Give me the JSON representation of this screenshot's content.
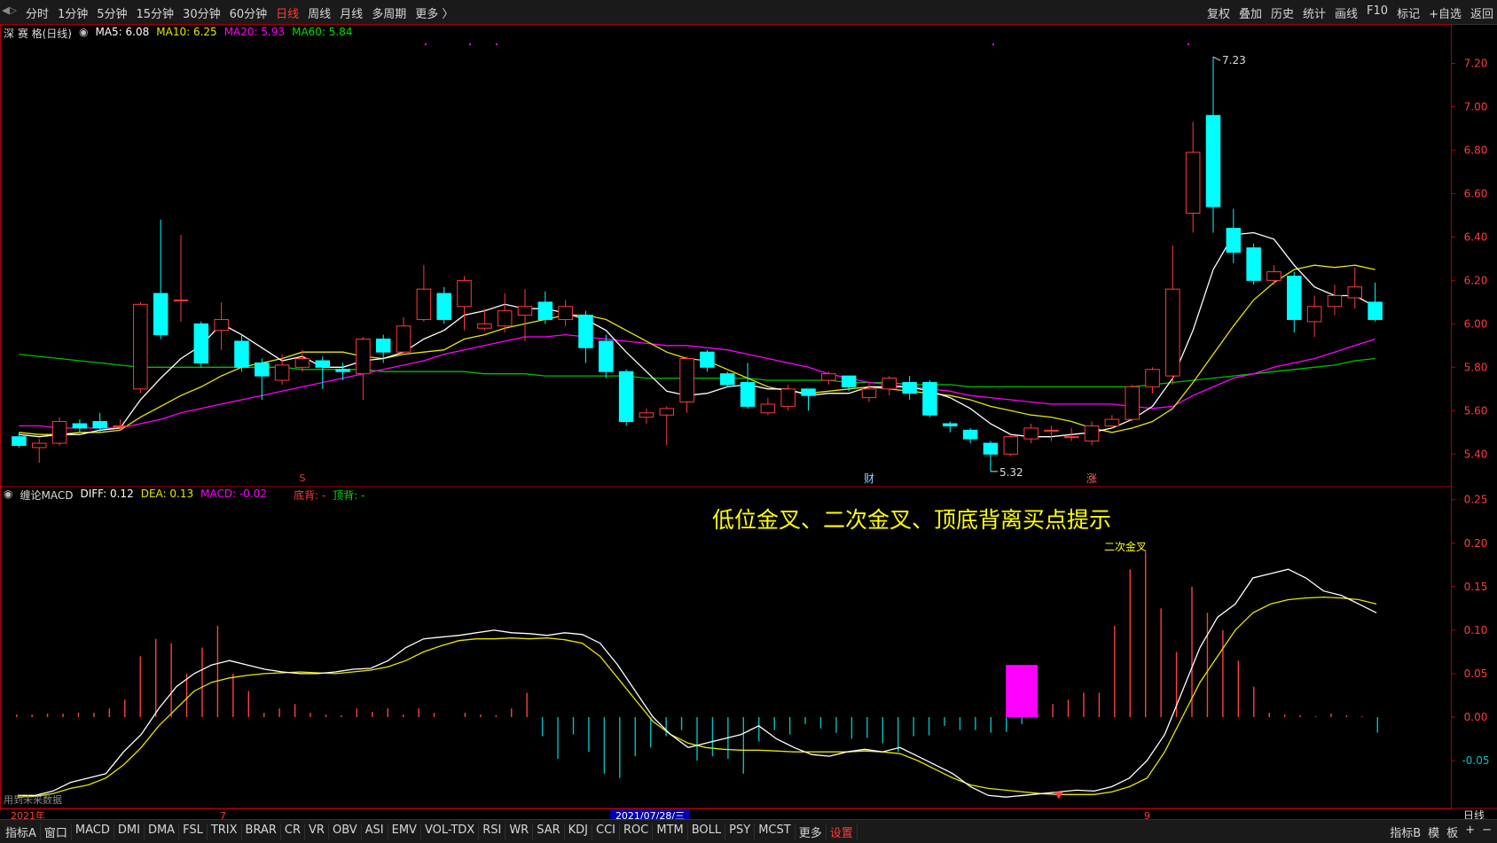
{
  "topbar": {
    "left_items": [
      "分时",
      "1分钟",
      "5分钟",
      "15分钟",
      "30分钟",
      "60分钟",
      "日线",
      "周线",
      "月线",
      "多周期",
      "更多 〉"
    ],
    "active_index": 6,
    "right_items": [
      "复权",
      "叠加",
      "历史",
      "统计",
      "画线",
      "F10",
      "标记",
      "+自选",
      "返回"
    ]
  },
  "price_header": {
    "name": "深 赛 格(日线)",
    "ma5": "MA5: 6.08",
    "ma10": "MA10: 6.25",
    "ma20": "MA20: 5.93",
    "ma60": "MA60: 5.84"
  },
  "macd_header": {
    "name": "缠论MACD",
    "diff": "DIFF: 0.12",
    "dea": "DEA: 0.13",
    "macd": "MACD: -0.02",
    "bottom_div": "底背: -",
    "top_div": "顶背: -"
  },
  "annotations": {
    "main_title": "低位金叉、二次金叉、顶底背离买点提示",
    "second_cross": "二次金叉",
    "high_label": "7.23",
    "low_label": "5.32"
  },
  "x_axis": {
    "start_label": "2021年",
    "month_labels": [
      "7",
      "9"
    ],
    "cursor_date": "2021/07/28/三",
    "period": "日线"
  },
  "markers": {
    "cai": "财",
    "zhang": "涨",
    "s": "S"
  },
  "bottom": {
    "tabs": [
      "指标A",
      "窗口",
      "MACD",
      "DMI",
      "DMA",
      "FSL",
      "TRIX",
      "BRAR",
      "CR",
      "VR",
      "OBV",
      "ASI",
      "EMV",
      "VOL-TDX",
      "RSI",
      "WR",
      "SAR",
      "KDJ",
      "CCI",
      "ROC",
      "MTM",
      "BOLL",
      "PSY",
      "MCST",
      "更多",
      "设置"
    ],
    "active_index": 25,
    "right_items": [
      "指标B",
      "模",
      "板",
      "+",
      "−"
    ],
    "future_note": "用到未来数据"
  },
  "colors": {
    "up": "#ff3b3b",
    "down": "#00ffff",
    "ma5": "#ffffff",
    "ma10": "#e6e600",
    "ma20": "#ff00ff",
    "ma60": "#00c000",
    "diff": "#ffffff",
    "dea": "#e6e600",
    "frame": "#b00000",
    "signal": "#ff00ff"
  },
  "chart_data": [
    {
      "type": "candlestick",
      "title": "深 赛 格(日线)",
      "y_ticks": [
        5.4,
        5.6,
        5.8,
        6.0,
        6.2,
        6.4,
        6.6,
        6.8,
        7.0,
        7.2
      ],
      "ylim": [
        5.25,
        7.3
      ],
      "candles": [
        [
          5.48,
          5.44,
          5.5,
          5.43
        ],
        [
          5.43,
          5.45,
          5.47,
          5.36
        ],
        [
          5.45,
          5.55,
          5.57,
          5.44
        ],
        [
          5.54,
          5.52,
          5.56,
          5.5
        ],
        [
          5.55,
          5.52,
          5.59,
          5.5
        ],
        [
          5.53,
          5.53,
          5.56,
          5.51
        ],
        [
          5.7,
          6.09,
          6.1,
          5.68
        ],
        [
          6.14,
          5.95,
          6.48,
          5.93
        ],
        [
          6.11,
          6.11,
          6.41,
          6.01
        ],
        [
          6.0,
          5.82,
          6.01,
          5.8
        ],
        [
          5.97,
          6.02,
          6.1,
          5.88
        ],
        [
          5.92,
          5.8,
          5.95,
          5.78
        ],
        [
          5.82,
          5.76,
          5.84,
          5.65
        ],
        [
          5.74,
          5.81,
          5.86,
          5.72
        ],
        [
          5.8,
          5.84,
          5.88,
          5.78
        ],
        [
          5.83,
          5.8,
          5.85,
          5.7
        ],
        [
          5.79,
          5.78,
          5.82,
          5.74
        ],
        [
          5.77,
          5.93,
          5.94,
          5.65
        ],
        [
          5.93,
          5.87,
          5.95,
          5.82
        ],
        [
          5.87,
          5.99,
          6.03,
          5.86
        ],
        [
          6.02,
          6.16,
          6.27,
          6.01
        ],
        [
          6.14,
          6.02,
          6.17,
          6.0
        ],
        [
          6.08,
          6.2,
          6.22,
          5.97
        ],
        [
          5.98,
          6.0,
          6.07,
          5.97
        ],
        [
          5.99,
          6.06,
          6.14,
          5.96
        ],
        [
          6.04,
          6.08,
          6.16,
          5.92
        ],
        [
          6.1,
          6.02,
          6.15,
          6.0
        ],
        [
          6.02,
          6.08,
          6.11,
          5.99
        ],
        [
          6.04,
          5.89,
          6.06,
          5.82
        ],
        [
          5.92,
          5.78,
          5.95,
          5.75
        ],
        [
          5.78,
          5.55,
          5.79,
          5.53
        ],
        [
          5.57,
          5.59,
          5.61,
          5.54
        ],
        [
          5.58,
          5.61,
          5.62,
          5.44
        ],
        [
          5.64,
          5.84,
          5.85,
          5.59
        ],
        [
          5.87,
          5.8,
          5.88,
          5.78
        ],
        [
          5.77,
          5.72,
          5.78,
          5.71
        ],
        [
          5.73,
          5.62,
          5.82,
          5.61
        ],
        [
          5.59,
          5.63,
          5.66,
          5.58
        ],
        [
          5.62,
          5.7,
          5.72,
          5.6
        ],
        [
          5.7,
          5.67,
          5.7,
          5.6
        ],
        [
          5.74,
          5.77,
          5.78,
          5.72
        ],
        [
          5.76,
          5.71,
          5.76,
          5.69
        ],
        [
          5.66,
          5.7,
          5.73,
          5.64
        ],
        [
          5.7,
          5.75,
          5.76,
          5.67
        ],
        [
          5.73,
          5.68,
          5.76,
          5.65
        ],
        [
          5.73,
          5.58,
          5.74,
          5.57
        ],
        [
          5.54,
          5.53,
          5.55,
          5.5
        ],
        [
          5.51,
          5.47,
          5.52,
          5.45
        ],
        [
          5.45,
          5.4,
          5.46,
          5.32
        ],
        [
          5.4,
          5.48,
          5.49,
          5.39
        ],
        [
          5.47,
          5.52,
          5.54,
          5.45
        ],
        [
          5.51,
          5.51,
          5.53,
          5.46
        ],
        [
          5.48,
          5.48,
          5.52,
          5.46
        ],
        [
          5.46,
          5.53,
          5.55,
          5.44
        ],
        [
          5.53,
          5.56,
          5.58,
          5.52
        ],
        [
          5.56,
          5.71,
          5.72,
          5.55
        ],
        [
          5.71,
          5.79,
          5.8,
          5.68
        ],
        [
          5.76,
          6.16,
          6.36,
          5.72
        ],
        [
          6.51,
          6.79,
          6.93,
          6.42
        ],
        [
          6.96,
          6.54,
          7.23,
          6.42
        ],
        [
          6.44,
          6.33,
          6.53,
          6.28
        ],
        [
          6.35,
          6.2,
          6.37,
          6.18
        ],
        [
          6.2,
          6.24,
          6.27,
          6.18
        ],
        [
          6.22,
          6.02,
          6.24,
          5.96
        ],
        [
          6.01,
          6.08,
          6.13,
          5.94
        ],
        [
          6.08,
          6.13,
          6.18,
          6.04
        ],
        [
          6.12,
          6.17,
          6.26,
          6.07
        ],
        [
          6.1,
          6.02,
          6.19,
          6.01
        ]
      ],
      "ma5": [
        5.49,
        5.48,
        5.49,
        5.49,
        5.51,
        5.52,
        5.65,
        5.75,
        5.84,
        5.9,
        6.0,
        5.95,
        5.89,
        5.83,
        5.85,
        5.8,
        5.8,
        5.83,
        5.84,
        5.87,
        5.93,
        5.97,
        6.04,
        6.06,
        6.09,
        6.07,
        6.07,
        6.05,
        6.02,
        5.97,
        5.87,
        5.78,
        5.69,
        5.67,
        5.68,
        5.71,
        5.72,
        5.7,
        5.7,
        5.67,
        5.68,
        5.68,
        5.71,
        5.71,
        5.71,
        5.69,
        5.66,
        5.61,
        5.54,
        5.49,
        5.48,
        5.48,
        5.49,
        5.5,
        5.52,
        5.56,
        5.62,
        5.75,
        5.97,
        6.25,
        6.41,
        6.42,
        6.39,
        6.27,
        6.17,
        6.13,
        6.13,
        6.08
      ],
      "ma10": [
        5.5,
        5.49,
        5.49,
        5.5,
        5.5,
        5.51,
        5.57,
        5.62,
        5.67,
        5.71,
        5.76,
        5.8,
        5.82,
        5.84,
        5.87,
        5.87,
        5.87,
        5.85,
        5.84,
        5.86,
        5.87,
        5.88,
        5.93,
        5.95,
        5.98,
        6.0,
        6.02,
        6.04,
        6.04,
        6.02,
        5.97,
        5.92,
        5.87,
        5.84,
        5.83,
        5.79,
        5.75,
        5.71,
        5.69,
        5.68,
        5.69,
        5.7,
        5.71,
        5.7,
        5.69,
        5.68,
        5.67,
        5.65,
        5.62,
        5.6,
        5.58,
        5.57,
        5.55,
        5.52,
        5.5,
        5.52,
        5.55,
        5.61,
        5.73,
        5.86,
        5.99,
        6.11,
        6.19,
        6.25,
        6.27,
        6.26,
        6.27,
        6.25
      ],
      "ma20": [
        5.53,
        5.53,
        5.52,
        5.52,
        5.52,
        5.52,
        5.54,
        5.56,
        5.59,
        5.61,
        5.63,
        5.65,
        5.67,
        5.69,
        5.71,
        5.73,
        5.75,
        5.77,
        5.79,
        5.81,
        5.83,
        5.86,
        5.88,
        5.9,
        5.92,
        5.94,
        5.94,
        5.95,
        5.94,
        5.93,
        5.92,
        5.91,
        5.9,
        5.9,
        5.89,
        5.88,
        5.86,
        5.84,
        5.82,
        5.8,
        5.77,
        5.75,
        5.73,
        5.72,
        5.71,
        5.7,
        5.69,
        5.67,
        5.66,
        5.65,
        5.64,
        5.63,
        5.63,
        5.63,
        5.63,
        5.62,
        5.61,
        5.62,
        5.67,
        5.71,
        5.75,
        5.77,
        5.8,
        5.82,
        5.84,
        5.87,
        5.9,
        5.93
      ],
      "ma60": [
        5.86,
        5.85,
        5.84,
        5.83,
        5.82,
        5.81,
        5.8,
        5.8,
        5.8,
        5.8,
        5.8,
        5.8,
        5.8,
        5.8,
        5.79,
        5.79,
        5.79,
        5.79,
        5.78,
        5.78,
        5.78,
        5.78,
        5.78,
        5.77,
        5.77,
        5.77,
        5.76,
        5.76,
        5.76,
        5.76,
        5.76,
        5.75,
        5.75,
        5.75,
        5.75,
        5.75,
        5.75,
        5.74,
        5.74,
        5.74,
        5.74,
        5.73,
        5.73,
        5.73,
        5.72,
        5.72,
        5.72,
        5.71,
        5.71,
        5.71,
        5.71,
        5.71,
        5.71,
        5.71,
        5.71,
        5.71,
        5.72,
        5.73,
        5.74,
        5.75,
        5.76,
        5.77,
        5.78,
        5.79,
        5.8,
        5.81,
        5.83,
        5.84
      ]
    },
    {
      "type": "macd",
      "title": "缠论MACD",
      "y_ticks": [
        -0.05,
        0.0,
        0.05,
        0.1,
        0.15,
        0.2,
        0.25
      ],
      "ylim": [
        -0.105,
        0.265
      ],
      "diff": [
        -0.09,
        -0.09,
        -0.085,
        -0.075,
        -0.07,
        -0.065,
        -0.04,
        -0.02,
        0.01,
        0.035,
        0.05,
        0.06,
        0.065,
        0.06,
        0.055,
        0.052,
        0.05,
        0.05,
        0.052,
        0.055,
        0.056,
        0.065,
        0.08,
        0.09,
        0.092,
        0.094,
        0.097,
        0.1,
        0.097,
        0.096,
        0.094,
        0.097,
        0.095,
        0.085,
        0.06,
        0.03,
        0.0,
        -0.02,
        -0.035,
        -0.03,
        -0.025,
        -0.02,
        -0.01,
        -0.025,
        -0.035,
        -0.043,
        -0.045,
        -0.04,
        -0.037,
        -0.04,
        -0.035,
        -0.045,
        -0.055,
        -0.065,
        -0.08,
        -0.09,
        -0.092,
        -0.09,
        -0.088,
        -0.086,
        -0.084,
        -0.085,
        -0.08,
        -0.07,
        -0.05,
        -0.02,
        0.03,
        0.08,
        0.115,
        0.13,
        0.16,
        0.165,
        0.17,
        0.16,
        0.145,
        0.14,
        0.13,
        0.12
      ],
      "dea": [
        -0.092,
        -0.091,
        -0.088,
        -0.082,
        -0.078,
        -0.07,
        -0.055,
        -0.035,
        -0.01,
        0.01,
        0.03,
        0.04,
        0.045,
        0.048,
        0.05,
        0.051,
        0.052,
        0.051,
        0.05,
        0.052,
        0.054,
        0.058,
        0.065,
        0.075,
        0.082,
        0.088,
        0.09,
        0.09,
        0.091,
        0.09,
        0.091,
        0.089,
        0.085,
        0.07,
        0.045,
        0.02,
        -0.005,
        -0.02,
        -0.03,
        -0.035,
        -0.037,
        -0.038,
        -0.038,
        -0.039,
        -0.04,
        -0.04,
        -0.04,
        -0.04,
        -0.039,
        -0.04,
        -0.042,
        -0.05,
        -0.06,
        -0.07,
        -0.078,
        -0.082,
        -0.084,
        -0.086,
        -0.088,
        -0.089,
        -0.089,
        -0.089,
        -0.086,
        -0.08,
        -0.07,
        -0.04,
        0.0,
        0.04,
        0.07,
        0.1,
        0.12,
        0.13,
        0.135,
        0.137,
        0.138,
        0.137,
        0.135,
        0.13
      ],
      "hist": [
        0.003,
        0.003,
        0.004,
        0.004,
        0.005,
        0.005,
        0.01,
        0.02,
        0.07,
        0.09,
        0.085,
        0.05,
        0.08,
        0.105,
        0.05,
        0.03,
        0.005,
        0.01,
        0.015,
        0.005,
        0.003,
        0.002,
        0.01,
        0.006,
        0.01,
        0.003,
        0.01,
        0.005,
        0.0,
        0.005,
        0.003,
        0.002,
        0.01,
        0.028,
        -0.022,
        -0.048,
        -0.02,
        -0.04,
        -0.065,
        -0.07,
        -0.045,
        -0.035,
        -0.022,
        -0.015,
        -0.05,
        -0.045,
        -0.048,
        -0.065,
        -0.028,
        -0.015,
        -0.02,
        -0.008,
        -0.013,
        -0.018,
        -0.025,
        -0.024,
        -0.03,
        -0.04,
        -0.022,
        -0.021,
        -0.01,
        -0.015,
        -0.015,
        -0.018,
        -0.017,
        -0.008,
        0.005,
        0.015,
        0.02,
        0.028,
        0.028,
        0.105,
        0.17,
        0.19,
        0.125,
        0.075,
        0.15,
        0.12,
        0.1,
        0.065,
        0.035,
        0.005,
        0.003,
        0.002,
        0.001,
        0.004,
        0.002,
        0.001,
        -0.018
      ],
      "signal_bar": {
        "value": 0.06,
        "index": 65
      }
    }
  ]
}
